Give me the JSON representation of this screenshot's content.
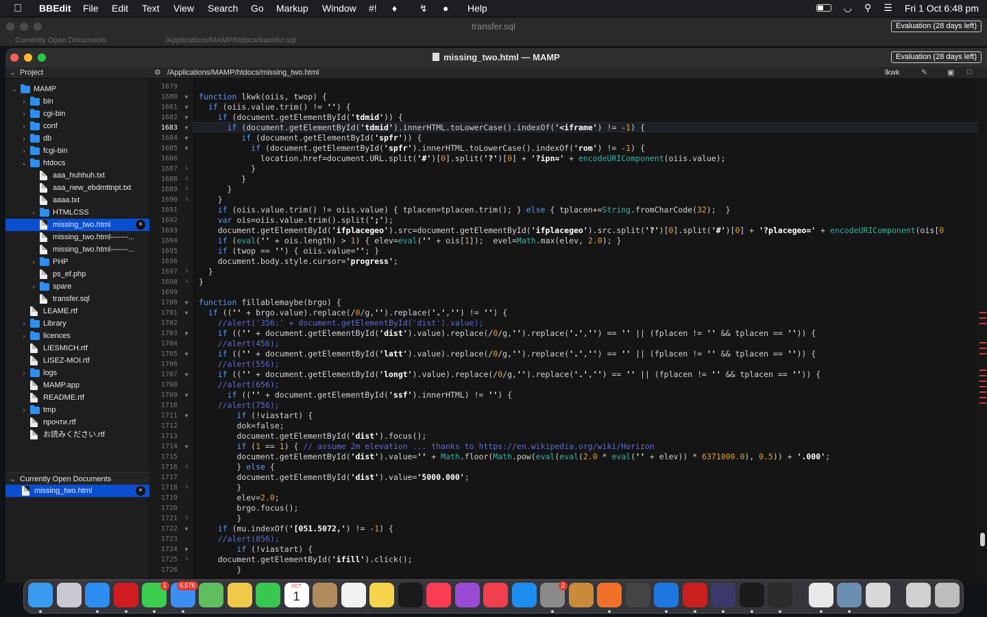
{
  "menubar": {
    "app": "BBEdit",
    "items": [
      "File",
      "Edit",
      "Text",
      "View",
      "Search",
      "Go",
      "Markup",
      "Window",
      "#!",
      "Help"
    ],
    "clock": "Fri 1 Oct  6:48 pm"
  },
  "back_window": {
    "title": "transfer.sql",
    "evaluation": "Evaluation (28 days left)",
    "sidebar_label": "Currently Open Documents",
    "path": "/Applications/MAMP/htdocs/transfer.sql"
  },
  "window": {
    "title": "missing_two.html — MAMP",
    "evaluation": "Evaluation (28 days left)",
    "path": "/Applications/MAMP/htdocs/missing_two.html",
    "function_popup": "lkwk"
  },
  "sidebar": {
    "project_label": "Project",
    "open_docs_label": "Currently Open Documents",
    "open_docs": [
      {
        "name": "missing_two.html",
        "selected": true
      }
    ],
    "tree": [
      {
        "name": "MAMP",
        "type": "folder",
        "depth": 0,
        "expanded": true
      },
      {
        "name": "bin",
        "type": "folder",
        "depth": 1
      },
      {
        "name": "cgi-bin",
        "type": "folder",
        "depth": 1
      },
      {
        "name": "conf",
        "type": "folder",
        "depth": 1
      },
      {
        "name": "db",
        "type": "folder",
        "depth": 1
      },
      {
        "name": "fcgi-bin",
        "type": "folder",
        "depth": 1
      },
      {
        "name": "htdocs",
        "type": "folder",
        "depth": 1,
        "expanded": true
      },
      {
        "name": "aaa_huhhuh.txt",
        "type": "file",
        "depth": 2
      },
      {
        "name": "aaa_new_ebdmttnpt.txt",
        "type": "file",
        "depth": 2
      },
      {
        "name": "aaaa.txt",
        "type": "file",
        "depth": 2
      },
      {
        "name": "HTMLCSS",
        "type": "folder",
        "depth": 2
      },
      {
        "name": "missing_two.html",
        "type": "file",
        "depth": 2,
        "selected": true
      },
      {
        "name": "missing_two.html-------...",
        "type": "file",
        "depth": 2
      },
      {
        "name": "missing_two.html-------...",
        "type": "file",
        "depth": 2
      },
      {
        "name": "PHP",
        "type": "folder",
        "depth": 2
      },
      {
        "name": "ps_ef.php",
        "type": "file",
        "depth": 2
      },
      {
        "name": "spare",
        "type": "folder",
        "depth": 2
      },
      {
        "name": "transfer.sql",
        "type": "file",
        "depth": 2
      },
      {
        "name": "LEAME.rtf",
        "type": "file",
        "depth": 1
      },
      {
        "name": "Library",
        "type": "folder",
        "depth": 1
      },
      {
        "name": "licences",
        "type": "folder",
        "depth": 1
      },
      {
        "name": "LIESMICH.rtf",
        "type": "file",
        "depth": 1
      },
      {
        "name": "LISEZ-MOI.rtf",
        "type": "file",
        "depth": 1
      },
      {
        "name": "logs",
        "type": "folder",
        "depth": 1
      },
      {
        "name": "MAMP.app",
        "type": "file",
        "depth": 1
      },
      {
        "name": "README.rtf",
        "type": "file",
        "depth": 1
      },
      {
        "name": "tmp",
        "type": "folder",
        "depth": 1
      },
      {
        "name": "прочти.rtf",
        "type": "file",
        "depth": 1
      },
      {
        "name": "お読みください.rtf",
        "type": "file",
        "depth": 1
      }
    ]
  },
  "editor": {
    "first_line": 1679,
    "lines": [
      "",
      "function lkwk(oiis, twop) {",
      "  if (oiis.value.trim() != '') {",
      "    if (document.getElementById('tdmid')) {",
      "      if (document.getElementById('tdmid').innerHTML.toLowerCase().indexOf('<iframe') != -1) {",
      "         if (document.getElementById('spfr')) {",
      "           if (document.getElementById('spfr').innerHTML.toLowerCase().indexOf('rom') != -1) {",
      "             location.href=document.URL.split('#')[0].split('?')[0] + '?ipn=' + encodeURIComponent(oiis.value);",
      "           }",
      "         }",
      "      }",
      "    }",
      "    if (oiis.value.trim() != oiis.value) { tplacen=tplacen.trim(); } else { tplacen+=String.fromCharCode(32);  }",
      "    var ois=oiis.value.trim().split(';');",
      "    document.getElementById('ifplacegeo').src=document.getElementById('ifplacegeo').src.split('?')[0].split('#')[0] + '?placegeo=' + encodeURIComponent(ois[0",
      "    if (eval('' + ois.length) > 1) { elev=eval('' + ois[1]);  evel=Math.max(elev, 2.0); }",
      "    if (twop == '') { oiis.value=''; }",
      "    document.body.style.cursor='progress';",
      "  }",
      "}",
      "",
      "function fillablemaybe(brgo) {",
      "  if (('' + brgo.value).replace(/0/g,'').replace('.','') != '') {",
      "    //alert('356:' + document.getElementById('dist').value);",
      "    if (('' + document.getElementById('dist').value).replace(/0/g,'').replace('.','') == '' || (fplacen != '' && tplacen == '')) {",
      "    //alert(456);",
      "    if (('' + document.getElementById('latt').value).replace(/0/g,'').replace('.','') == '' || (fplacen != '' && tplacen == '')) {",
      "    //alert(556);",
      "    if (('' + document.getElementById('longt').value).replace(/0/g,'').replace('.','') == '' || (fplacen != '' && tplacen == '')) {",
      "    //alert(656);",
      "      if (('' + document.getElementById('ssf').innerHTML) != '') {",
      "    //alert(756);",
      "        if (!viastart) {",
      "        dok=false;",
      "        document.getElementById('dist').focus();",
      "        if (1 == 1) { // assume 2m elevation ... thanks to https://en.wikipedia.org/wiki/Horizon",
      "        document.getElementById('dist').value='' + Math.floor(Math.pow(eval(eval(2.0 * eval('' + elev)) * 6371000.0), 0.5)) + '.000';",
      "        } else {",
      "        document.getElementById('dist').value='5000.000';",
      "        }",
      "        elev=2.0;",
      "        brgo.focus();",
      "        }",
      "    if (mu.indexOf('[051.5072,') != -1) {",
      "    //alert(856);",
      "        if (!viastart) {",
      "    document.getElementById('ifill').click();",
      "        }"
    ]
  },
  "dock": {
    "mail_badge": "6,576",
    "messages_badge": "1",
    "settings_badge": "2",
    "calendar_month": "OCT",
    "calendar_day": "1"
  }
}
